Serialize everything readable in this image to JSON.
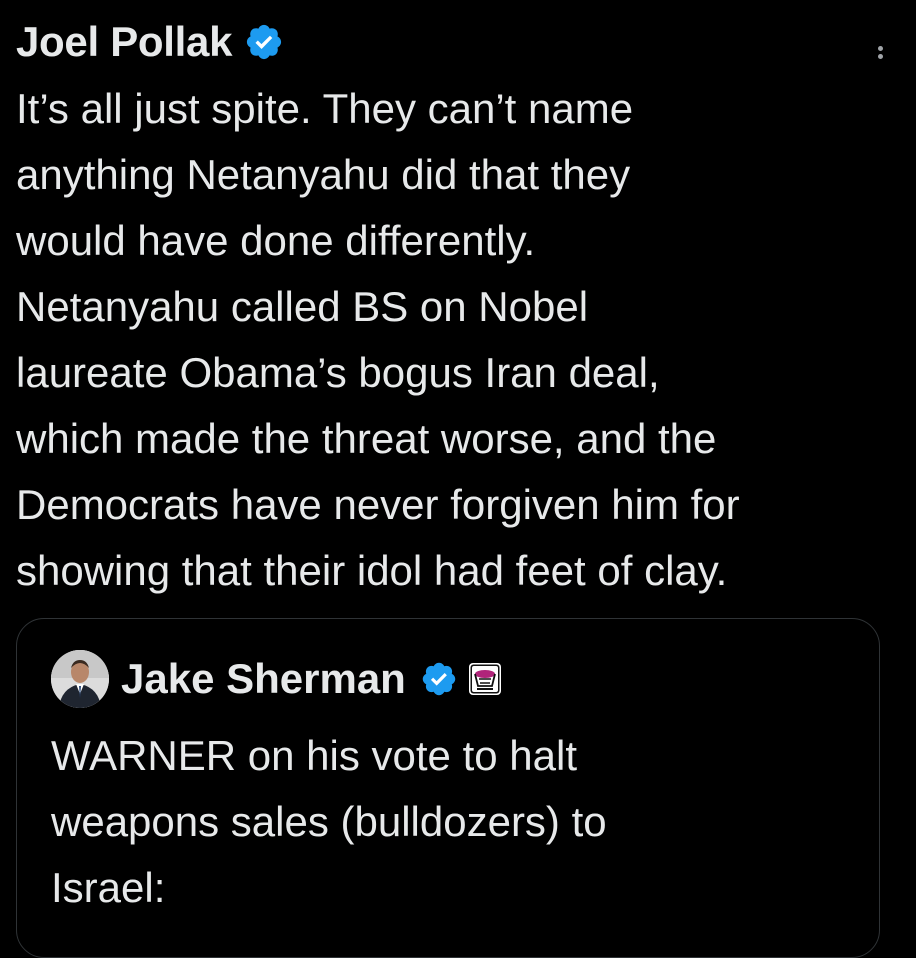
{
  "tweet": {
    "author_name": "Joel Pollak",
    "text": "It’s all just spite. They can’t name\nanything Netanyahu did that they\nwould have done differently.\nNetanyahu called BS on Nobel\nlaureate Obama’s bogus Iran deal,\nwhich made the threat worse, and the\nDemocrats have never forgiven him for\nshowing that their idol had feet of clay."
  },
  "quoted_tweet": {
    "author_name": "Jake Sherman",
    "text": "WARNER on his vote to halt\nweapons sales (bulldozers) to\nIsrael:"
  },
  "icons": {
    "verified": "verified-badge-icon",
    "more": "more-options-icon",
    "affiliate": "affiliate-badge-icon",
    "avatar": "avatar"
  },
  "colors": {
    "background": "#000000",
    "text": "#e7e9ea",
    "verified_blue": "#1d9bf0",
    "border": "#2f3336"
  }
}
